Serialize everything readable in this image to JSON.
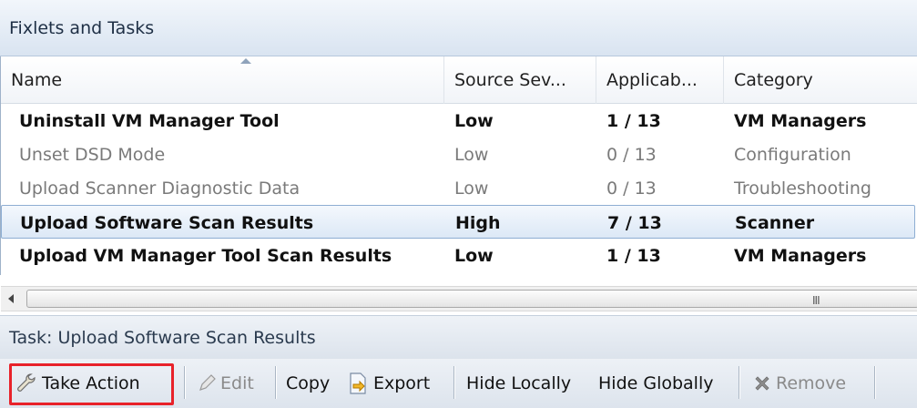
{
  "panel": {
    "title": "Fixlets and Tasks"
  },
  "table": {
    "columns": [
      "Name",
      "Source Sev...",
      "Applicab...",
      "Category"
    ],
    "rows": [
      {
        "name": "Uninstall VM Manager Tool",
        "severity": "Low",
        "applicable": "1 / 13",
        "category": "VM Managers"
      },
      {
        "name": "Unset DSD Mode",
        "severity": "Low",
        "applicable": "0 / 13",
        "category": "Configuration"
      },
      {
        "name": "Upload Scanner Diagnostic Data",
        "severity": "Low",
        "applicable": "0 / 13",
        "category": "Troubleshooting"
      },
      {
        "name": "Upload Software Scan Results",
        "severity": "High",
        "applicable": "7 / 13",
        "category": "Scanner"
      },
      {
        "name": "Upload VM Manager Tool Scan Results",
        "severity": "Low",
        "applicable": "1 / 13",
        "category": "VM Managers"
      }
    ],
    "scroll_grip": "III"
  },
  "task": {
    "title": "Task: Upload Software Scan Results"
  },
  "toolbar": {
    "take_action": "Take Action",
    "edit": "Edit",
    "copy": "Copy",
    "export": "Export",
    "hide_locally": "Hide Locally",
    "hide_globally": "Hide Globally",
    "remove": "Remove"
  },
  "colors": {
    "highlight": "#e8222a",
    "selection_border": "#8eaed3",
    "header_gradient_top": "#f2f6fb",
    "header_gradient_bottom": "#d9e4f1"
  }
}
